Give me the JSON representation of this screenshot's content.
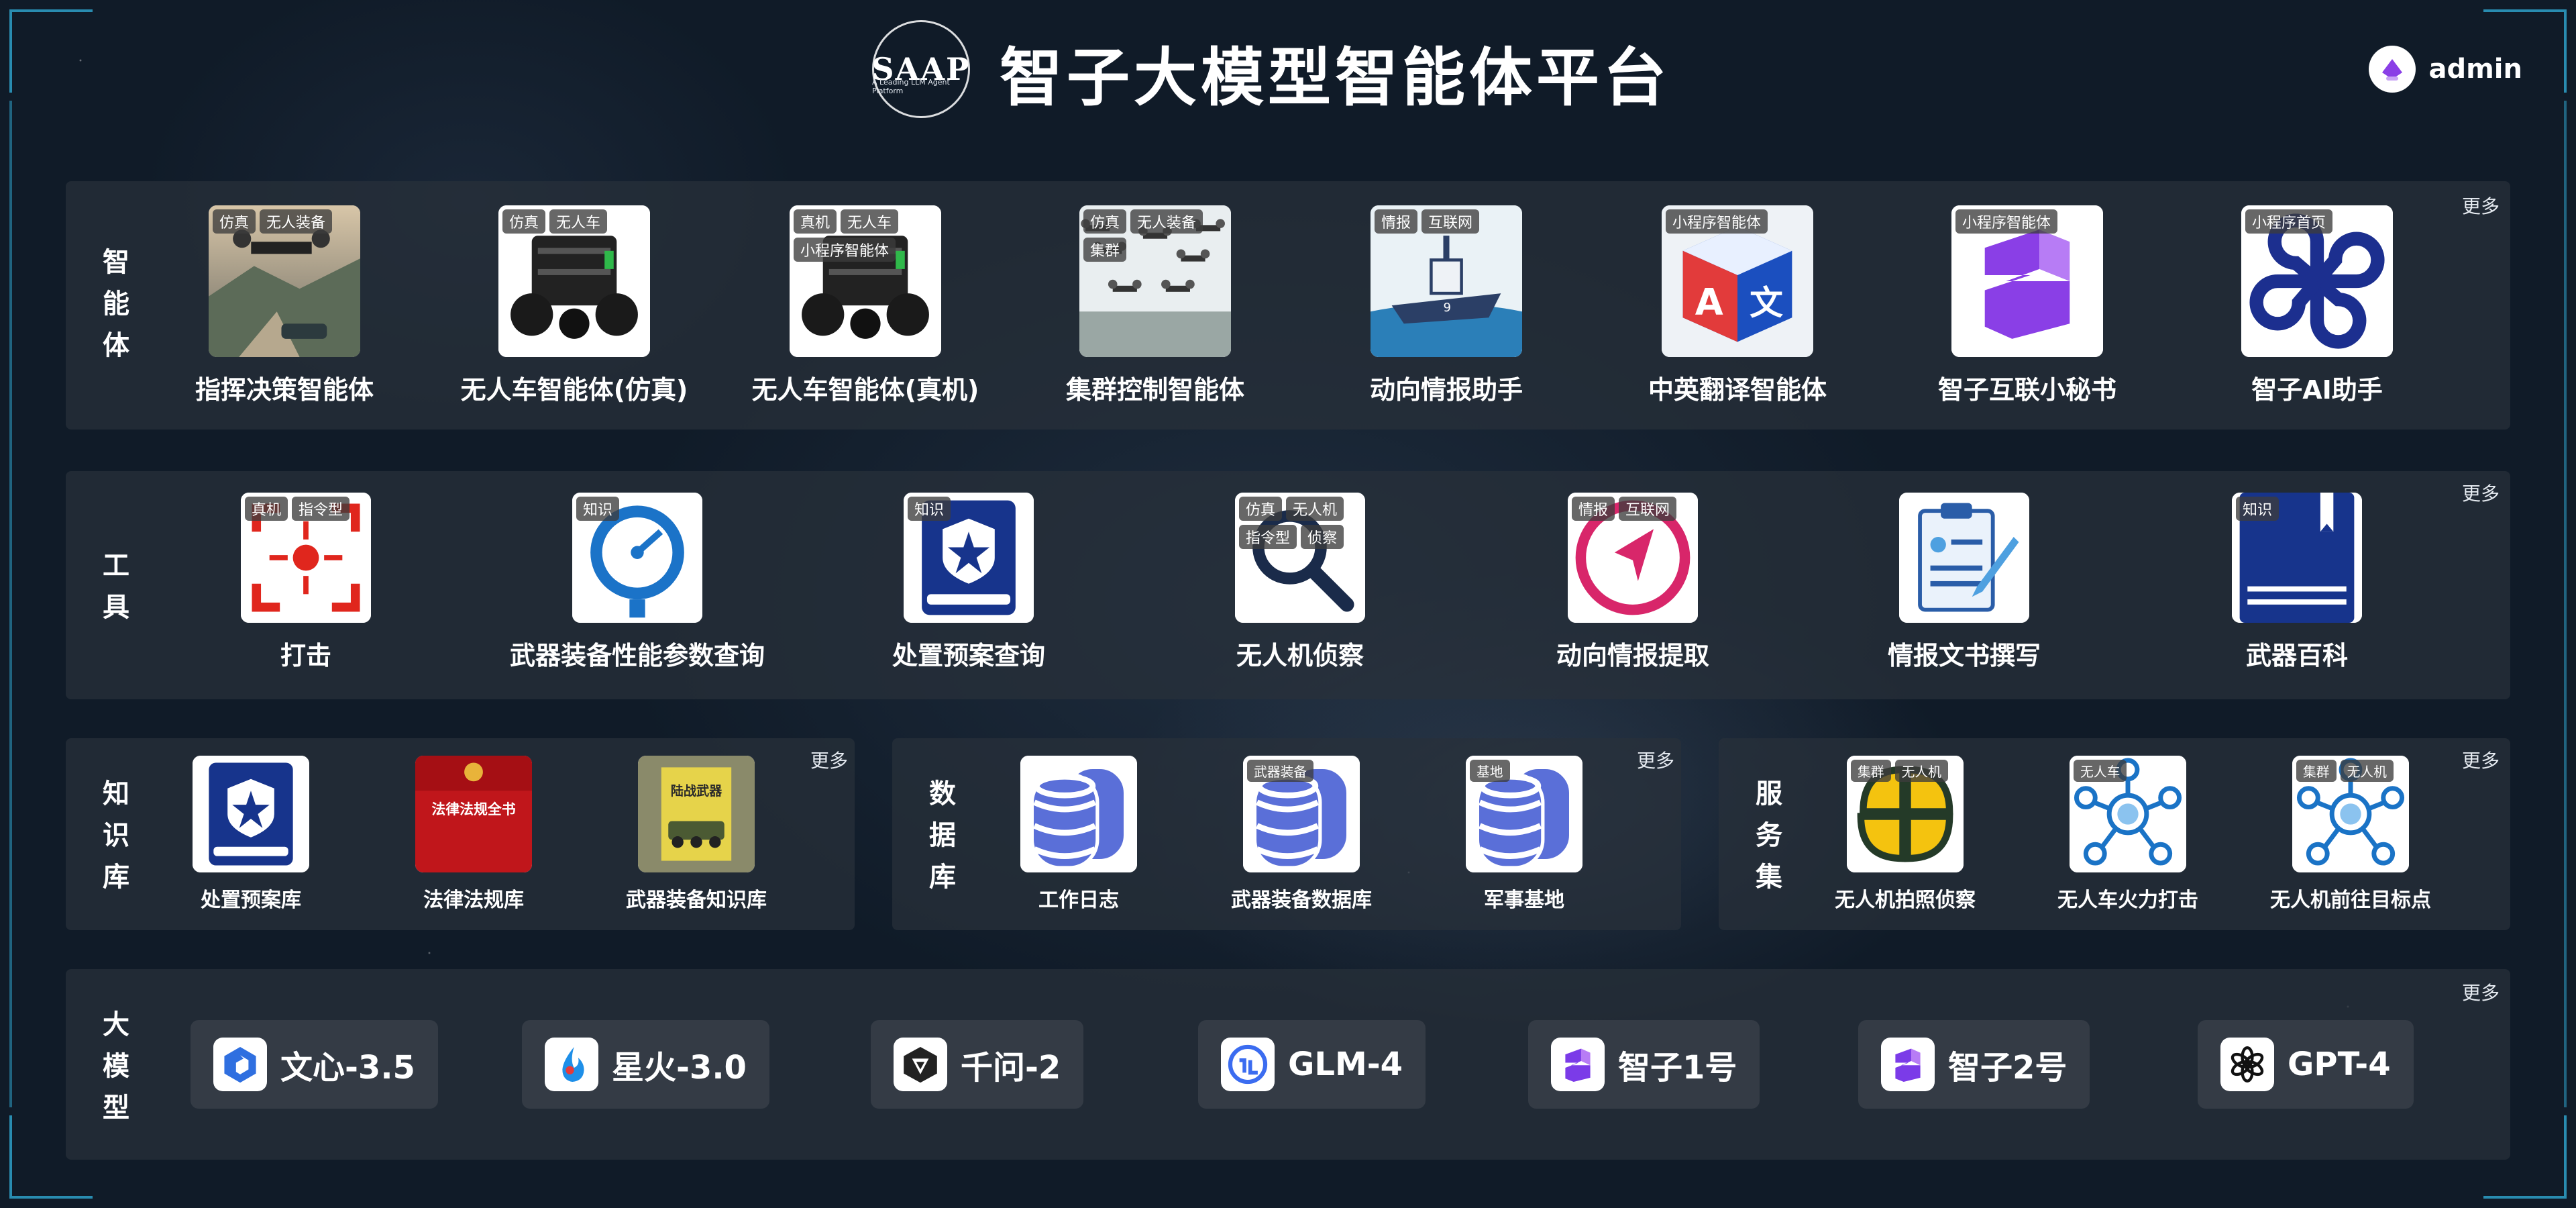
{
  "header": {
    "logo_text": "SAAP",
    "logo_subtitle": "A Leading LLM Agent Platform",
    "title": "智子大模型智能体平台",
    "user": "admin"
  },
  "more_label": "更多",
  "agents": {
    "label": "智能体",
    "items": [
      {
        "name": "指挥决策智能体",
        "tags": [
          "仿真",
          "无人装备"
        ],
        "icon": "drone-tank-photo"
      },
      {
        "name": "无人车智能体(仿真)",
        "tags": [
          "仿真",
          "无人车"
        ],
        "icon": "robot-car-photo"
      },
      {
        "name": "无人车智能体(真机)",
        "tags": [
          "真机",
          "无人车",
          "小程序智能体"
        ],
        "icon": "robot-car-photo"
      },
      {
        "name": "集群控制智能体",
        "tags": [
          "仿真",
          "无人装备",
          "集群"
        ],
        "icon": "drone-swarm-photo"
      },
      {
        "name": "动向情报助手",
        "tags": [
          "情报",
          "互联网"
        ],
        "icon": "warship-icon"
      },
      {
        "name": "中英翻译智能体",
        "tags": [
          "小程序智能体"
        ],
        "icon": "translate-cube-icon"
      },
      {
        "name": "智子互联小秘书",
        "tags": [
          "小程序智能体"
        ],
        "icon": "purple-z-icon"
      },
      {
        "name": "智子AI助手",
        "tags": [
          "小程序首页"
        ],
        "icon": "clover-icon"
      }
    ]
  },
  "tools": {
    "label": "工具",
    "items": [
      {
        "name": "打击",
        "tags": [
          "真机",
          "指令型"
        ],
        "icon": "target-icon"
      },
      {
        "name": "武器装备性能参数查询",
        "tags": [
          "知识"
        ],
        "icon": "gauge-icon"
      },
      {
        "name": "处置预案查询",
        "tags": [
          "知识"
        ],
        "icon": "shield-book-icon"
      },
      {
        "name": "无人机侦察",
        "tags": [
          "仿真",
          "无人机",
          "指令型",
          "侦察"
        ],
        "icon": "magnifier-icon"
      },
      {
        "name": "动向情报提取",
        "tags": [
          "情报",
          "互联网"
        ],
        "icon": "compass-icon"
      },
      {
        "name": "情报文书撰写",
        "tags": [],
        "icon": "clipboard-icon"
      },
      {
        "name": "武器百科",
        "tags": [
          "知识"
        ],
        "icon": "book-icon"
      }
    ]
  },
  "knowledge": {
    "label": "知识库",
    "items": [
      {
        "name": "处置预案库",
        "tags": [],
        "icon": "shield-book-icon"
      },
      {
        "name": "法律法规库",
        "tags": [],
        "icon": "law-book-icon"
      },
      {
        "name": "武器装备知识库",
        "tags": [],
        "icon": "weapon-book-icon"
      }
    ],
    "book_cover_text": "法律法规全书",
    "weapon_cover_text": "陆战武器"
  },
  "databases": {
    "label": "数据库",
    "items": [
      {
        "name": "工作日志",
        "tags": [],
        "icon": "database-icon"
      },
      {
        "name": "武器装备数据库",
        "tags": [
          "武器装备"
        ],
        "icon": "database-icon"
      },
      {
        "name": "军事基地",
        "tags": [
          "基地"
        ],
        "icon": "database-icon"
      }
    ]
  },
  "services": {
    "label": "服务集",
    "items": [
      {
        "name": "无人机拍照侦察",
        "tags": [
          "集群",
          "无人机"
        ],
        "icon": "clover-yellow-icon"
      },
      {
        "name": "无人车火力打击",
        "tags": [
          "无人车"
        ],
        "icon": "network-icon"
      },
      {
        "name": "无人机前往目标点",
        "tags": [
          "集群",
          "无人机"
        ],
        "icon": "network-icon"
      }
    ]
  },
  "models": {
    "label": "大模型",
    "items": [
      {
        "name": "文心-3.5",
        "icon": "wenxin-icon",
        "color": "#2f6fe0"
      },
      {
        "name": "星火-3.0",
        "icon": "xinghuo-icon",
        "color": "#1e8fe8"
      },
      {
        "name": "千问-2",
        "icon": "qianwen-icon",
        "color": "#222222"
      },
      {
        "name": "GLM-4",
        "icon": "glm-icon",
        "color": "#3b6cf0"
      },
      {
        "name": "智子1号",
        "icon": "zhizi-icon",
        "color": "#7b3be8"
      },
      {
        "name": "智子2号",
        "icon": "zhizi-icon",
        "color": "#7b3be8"
      },
      {
        "name": "GPT-4",
        "icon": "openai-icon",
        "color": "#111111"
      }
    ]
  }
}
